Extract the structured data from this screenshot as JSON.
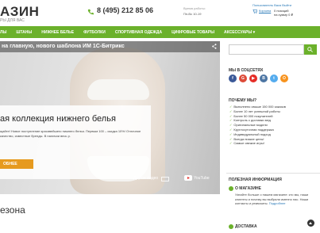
{
  "header": {
    "logo": "АЗИН",
    "logo_sub": "РЫ ДЛЯ ВАС",
    "phone": "8 (495) 212 85 06",
    "hours_label": "Время работы:",
    "hours": "Пн-Вс 10-19",
    "user_links": "Пользователь Вася   Выйти",
    "cart_link": "Корзина",
    "cart_count": "0 позиций",
    "cart_sum": "на сумму 0 ₽"
  },
  "nav": {
    "items": [
      "ЛЫ",
      "ШТАНЫ",
      "НИЖНЕЕ БЕЛЬЕ",
      "ФУТБОЛКИ",
      "СПОРТИВНАЯ ОДЕЖДА",
      "ЦИФРОВЫЕ ТОВАРЫ",
      "АКСЕССУАРЫ ▾"
    ]
  },
  "banner": {
    "video_title": "на главную, нового шаблона ИМ 1С-Битрикс",
    "heading": "ая коллекция нижнего белья",
    "text": "щайте! Новое поступление красивейшего нижнего белья. Первым 100 – скидка 10%! Отличное качество, известные бренды. В наличии весь р.",
    "button": "ОБНЕЕ",
    "watch_later": "Другое видео",
    "youtube": "YouTube"
  },
  "section": {
    "title": "езона"
  },
  "sidebar": {
    "search_placeholder": "",
    "social_title": "МЫ В СОЦСЕТЯХ",
    "social": [
      {
        "icon": "facebook-icon",
        "glyph": "f",
        "color": "#3b5998"
      },
      {
        "icon": "googleplus-icon",
        "glyph": "G",
        "color": "#dd4b39"
      },
      {
        "icon": "youtube-icon",
        "glyph": "▶",
        "color": "#e52d27"
      },
      {
        "icon": "vk-icon",
        "glyph": "В",
        "color": "#4c75a3"
      },
      {
        "icon": "twitter-icon",
        "glyph": "t",
        "color": "#55acee"
      },
      {
        "icon": "odnoklassniki-icon",
        "glyph": "О",
        "color": "#f7931e"
      }
    ],
    "why_title": "ПОЧЕМУ МЫ?",
    "why_items": [
      "Выполнено свыше 150 000 заказов",
      "Более 10 лет успешной работы",
      "Более 50 000 покупателей",
      "Контроль с доставки мед",
      "Оригинальные модели",
      "Круглосуточная поддержка",
      "Индивидуальный подход",
      "Всегда низкие цены!",
      "Самые свежие игры!"
    ],
    "useful_title": "ПОЛЕЗНАЯ ИНФОРМАЦИЯ",
    "about_title": "О МАГАЗИНЕ",
    "about_text": "Узнайте больше о нашем магазине: кто мы, наши клиенты и почему вы выбрали именно нас. Наши контакты и реквизиты.",
    "about_link": "Подробнее",
    "delivery_title": "ДОСТАВКА"
  },
  "colors": {
    "brand_green": "#6bb12b",
    "button_orange": "#e69a1f",
    "link_blue": "#2a7ab8"
  }
}
